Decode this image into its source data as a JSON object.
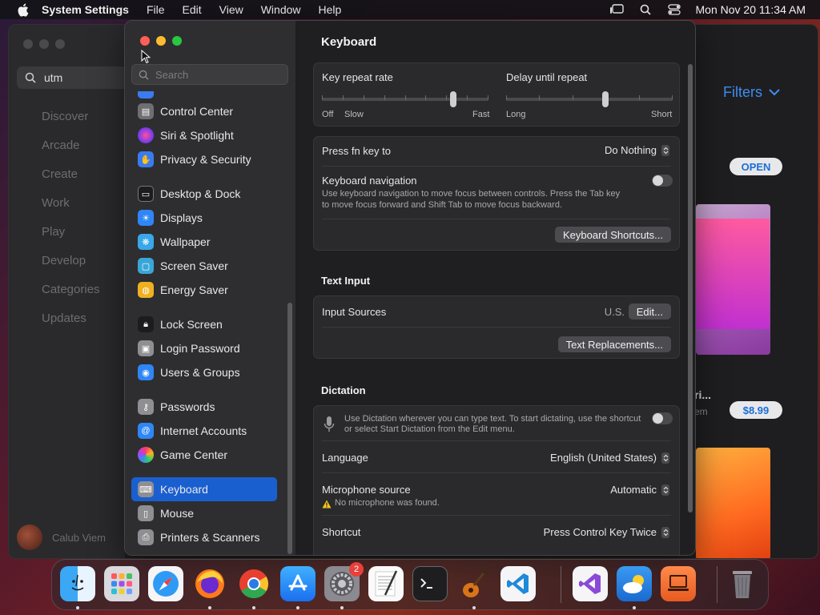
{
  "menubar": {
    "app_name": "System Settings",
    "items": [
      "File",
      "Edit",
      "View",
      "Window",
      "Help"
    ],
    "clock": "Mon Nov 20  11:34 AM"
  },
  "appstore": {
    "search_value": "utm",
    "nav": [
      "Discover",
      "Arcade",
      "Create",
      "Work",
      "Play",
      "Develop",
      "Categories",
      "Updates"
    ],
    "user_name": "Calub Viem",
    "filters_label": "Filters",
    "open_label": "OPEN",
    "price_label": "$8.99",
    "title_fragment": "ri...",
    "sub_fragment": "em"
  },
  "settings": {
    "search_placeholder": "Search",
    "sidebar": [
      {
        "label": "Control Center",
        "icon": "control-center-icon",
        "color": "#6e6e73"
      },
      {
        "label": "Siri & Spotlight",
        "icon": "siri-icon",
        "color": "#b04ad0"
      },
      {
        "label": "Privacy & Security",
        "icon": "privacy-hand-icon",
        "color": "#3a7cf0"
      },
      {
        "label": "Desktop & Dock",
        "icon": "desktop-dock-icon",
        "color": "#1c1c1e"
      },
      {
        "label": "Displays",
        "icon": "displays-icon",
        "color": "#2f86f5"
      },
      {
        "label": "Wallpaper",
        "icon": "wallpaper-icon",
        "color": "#38a8e8"
      },
      {
        "label": "Screen Saver",
        "icon": "screen-saver-icon",
        "color": "#3aa6d8"
      },
      {
        "label": "Energy Saver",
        "icon": "energy-saver-icon",
        "color": "#f0b020"
      },
      {
        "label": "Lock Screen",
        "icon": "lock-screen-icon",
        "color": "#1c1c1e"
      },
      {
        "label": "Login Password",
        "icon": "login-password-icon",
        "color": "#8e8e93"
      },
      {
        "label": "Users & Groups",
        "icon": "users-groups-icon",
        "color": "#2f86f5"
      },
      {
        "label": "Passwords",
        "icon": "passwords-key-icon",
        "color": "#8e8e93"
      },
      {
        "label": "Internet Accounts",
        "icon": "internet-accounts-icon",
        "color": "#2f86f5"
      },
      {
        "label": "Game Center",
        "icon": "game-center-icon",
        "color": "#f0f0f0"
      },
      {
        "label": "Keyboard",
        "icon": "keyboard-icon",
        "color": "#8e8e93"
      },
      {
        "label": "Mouse",
        "icon": "mouse-icon",
        "color": "#8e8e93"
      },
      {
        "label": "Printers & Scanners",
        "icon": "printer-icon",
        "color": "#8e8e93"
      }
    ],
    "selected": "Keyboard",
    "title": "Keyboard",
    "key_repeat": {
      "label": "Key repeat rate",
      "left": "Off",
      "left2": "Slow",
      "right": "Fast",
      "value_fraction": 0.8
    },
    "delay_repeat": {
      "label": "Delay until repeat",
      "left": "Long",
      "right": "Short",
      "value_fraction": 0.6
    },
    "fn_key": {
      "label": "Press fn key to",
      "value": "Do Nothing"
    },
    "keyboard_nav": {
      "label": "Keyboard navigation",
      "desc1": "Use keyboard navigation to move focus between controls. Press the Tab key",
      "desc2": "to move focus forward and Shift Tab to move focus backward.",
      "enabled": false
    },
    "shortcuts_button": "Keyboard Shortcuts...",
    "text_input": {
      "title": "Text Input",
      "input_sources_label": "Input Sources",
      "input_sources_value": "U.S.",
      "edit_button": "Edit...",
      "replacements_button": "Text Replacements..."
    },
    "dictation": {
      "title": "Dictation",
      "desc1": "Use Dictation wherever you can type text. To start dictating, use the shortcut",
      "desc2": "or select Start Dictation from the Edit menu.",
      "enabled": false,
      "language_label": "Language",
      "language_value": "English (United States)",
      "mic_label": "Microphone source",
      "mic_value": "Automatic",
      "mic_warning": "No microphone was found.",
      "shortcut_label": "Shortcut",
      "shortcut_value": "Press Control Key Twice"
    }
  },
  "dock": {
    "apps": [
      "finder",
      "launchpad",
      "safari",
      "firefox",
      "chrome",
      "app-store",
      "system-settings",
      "textedit",
      "terminal",
      "garageband",
      "vscode",
      "visual-studio",
      "weather",
      "sidecar",
      "trash"
    ],
    "settings_badge": "2"
  }
}
